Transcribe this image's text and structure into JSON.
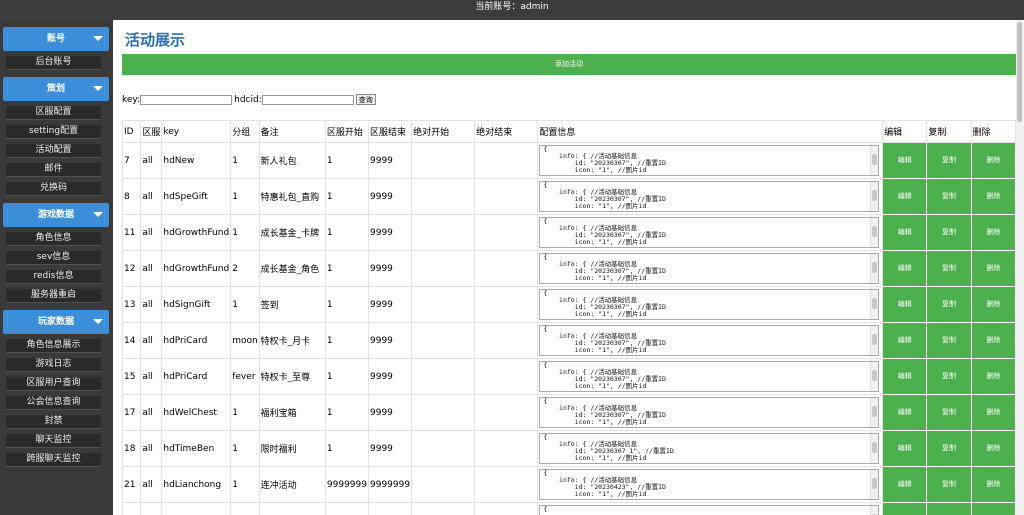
{
  "topbar": {
    "account_text": "当前账号：admin"
  },
  "sidebar": {
    "sections": [
      {
        "label": "账号",
        "items": [
          "后台账号"
        ]
      },
      {
        "label": "策划",
        "items": [
          "区服配置",
          "setting配置",
          "活动配置",
          "邮件",
          "兑换码"
        ]
      },
      {
        "label": "游戏数据",
        "items": [
          "角色信息",
          "sev信息",
          "redis信息",
          "服务器重启"
        ]
      },
      {
        "label": "玩家数据",
        "items": [
          "角色信息展示",
          "游戏日志",
          "区服用户查询",
          "公会信息查询",
          "封禁",
          "聊天监控",
          "跨服聊天监控"
        ]
      }
    ]
  },
  "main": {
    "title": "活动展示",
    "add_button": "添加活动",
    "search": {
      "key_label": "key:",
      "hdcid_label": "hdcid:",
      "query_button": "查询"
    },
    "columns": [
      "ID",
      "区服",
      "key",
      "分组",
      "备注",
      "区服开始",
      "区服结束",
      "绝对开始",
      "绝对结束",
      "配置信息",
      "编辑",
      "复制",
      "删除"
    ],
    "rows": [
      {
        "id": "7",
        "server": "all",
        "key": "hdNew",
        "group": "1",
        "note": "新人礼包",
        "start": "1",
        "end": "9999",
        "abs_start": "",
        "abs_end": "",
        "config": "{\n    info: { //活动基础信息\n        id: \"20230307\", //重置ID\n        icon: \"1\", //图片id"
      },
      {
        "id": "8",
        "server": "all",
        "key": "hdSpeGift",
        "group": "1",
        "note": "特惠礼包_直购",
        "start": "1",
        "end": "9999",
        "abs_start": "",
        "abs_end": "",
        "config": "{\n    info: { //活动基础信息\n        id: \"20230307\", //重置ID\n        icon: \"1\", //图片id"
      },
      {
        "id": "11",
        "server": "all",
        "key": "hdGrowthFund",
        "group": "1",
        "note": "成长基金_卡牌",
        "start": "1",
        "end": "9999",
        "abs_start": "",
        "abs_end": "",
        "config": "{\n    info: { //活动基础信息\n        id: \"20230307\", //重置ID\n        icon: \"1\", //图片id"
      },
      {
        "id": "12",
        "server": "all",
        "key": "hdGrowthFund",
        "group": "2",
        "note": "成长基金_角色",
        "start": "1",
        "end": "9999",
        "abs_start": "",
        "abs_end": "",
        "config": "{\n    info: { //活动基础信息\n        id: \"20230307\", //重置ID\n        icon: \"1\", //图片id"
      },
      {
        "id": "13",
        "server": "all",
        "key": "hdSignGift",
        "group": "1",
        "note": "签到",
        "start": "1",
        "end": "9999",
        "abs_start": "",
        "abs_end": "",
        "config": "{\n    info: { //活动基础信息\n        id: \"20230307\", //重置ID\n        icon: \"1\", //图片id"
      },
      {
        "id": "14",
        "server": "all",
        "key": "hdPriCard",
        "group": "moon",
        "note": "特权卡_月卡",
        "start": "1",
        "end": "9999",
        "abs_start": "",
        "abs_end": "",
        "config": "{\n    info: { //活动基础信息\n        id: \"20230307\", //重置ID\n        icon: \"1\", //图片id"
      },
      {
        "id": "15",
        "server": "all",
        "key": "hdPriCard",
        "group": "fever",
        "note": "特权卡_至尊",
        "start": "1",
        "end": "9999",
        "abs_start": "",
        "abs_end": "",
        "config": "{\n    info: { //活动基础信息\n        id: \"20230307\", //重置ID\n        icon: \"1\", //图片id"
      },
      {
        "id": "17",
        "server": "all",
        "key": "hdWelChest",
        "group": "1",
        "note": "福利宝箱",
        "start": "1",
        "end": "9999",
        "abs_start": "",
        "abs_end": "",
        "config": "{\n    info: { //活动基础信息\n        id: \"20230307\", //重置ID\n        icon: \"1\", //图片id"
      },
      {
        "id": "18",
        "server": "all",
        "key": "hdTimeBen",
        "group": "1",
        "note": "限时福利",
        "start": "1",
        "end": "9999",
        "abs_start": "",
        "abs_end": "",
        "config": "{\n    info: { //活动基础信息\n        id: \"20230307_1\", //重置ID\n        icon: \"1\", //图片id"
      },
      {
        "id": "21",
        "server": "all",
        "key": "hdLianchong",
        "group": "1",
        "note": "连冲活动",
        "start": "9999999",
        "end": "9999999",
        "abs_start": "",
        "abs_end": "",
        "config": "{\n    info: { //活动基础信息\n        id: \"20230423\", //重置ID\n        icon: \"1\", //图片id"
      },
      {
        "id": "",
        "server": "",
        "key": "",
        "group": "",
        "note": "",
        "start": "",
        "end": "",
        "abs_start": "",
        "abs_end": "",
        "config": "{"
      }
    ],
    "row_actions": {
      "edit": "编辑",
      "copy": "复制",
      "delete": "删除"
    }
  },
  "colors": {
    "accent_blue": "#3d8ed8",
    "green": "#4cb04c",
    "title_blue": "#2c6db0",
    "sidebar_bg": "#3a3a3a"
  }
}
